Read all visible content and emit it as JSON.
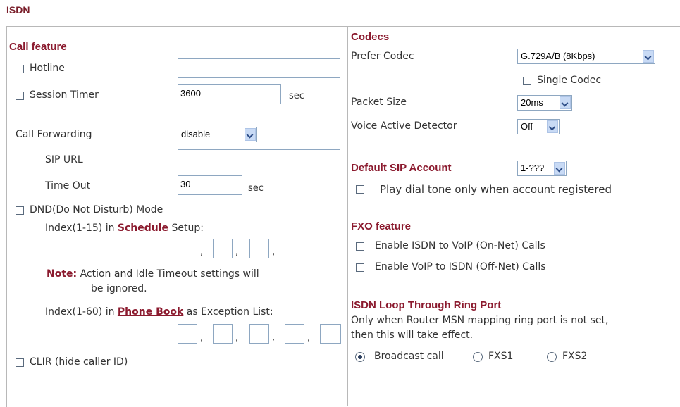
{
  "page_title": "ISDN",
  "left": {
    "call_feature": "Call feature",
    "hotline": {
      "label": "Hotline",
      "checked": false,
      "value": ""
    },
    "session_timer": {
      "label": "Session Timer",
      "checked": false,
      "value": "3600",
      "unit": "sec"
    },
    "call_forwarding": {
      "label": "Call Forwarding",
      "value": "disable"
    },
    "sip_url": {
      "label": "SIP URL",
      "value": ""
    },
    "time_out": {
      "label": "Time Out",
      "value": "30",
      "unit": "sec"
    },
    "dnd": {
      "label": "DND(Do Not Disturb) Mode",
      "checked": false
    },
    "schedule": {
      "prefix": "Index(1-15) in",
      "link": "Schedule",
      "suffix": "Setup:"
    },
    "note": {
      "label": "Note:",
      "line1": "Action and Idle Timeout settings will",
      "line2": "be ignored."
    },
    "phonebook": {
      "prefix": "Index(1-60) in",
      "link": "Phone Book",
      "suffix": "as Exception List:"
    },
    "clir": {
      "label": "CLIR (hide caller ID)",
      "checked": false
    }
  },
  "right": {
    "codecs": "Codecs",
    "prefer_codec": {
      "label": "Prefer Codec",
      "value": "G.729A/B (8Kbps)"
    },
    "single_codec": {
      "label": "Single Codec",
      "checked": false
    },
    "packet_size": {
      "label": "Packet Size",
      "value": "20ms"
    },
    "vad": {
      "label": "Voice Active Detector",
      "value": "Off"
    },
    "default_sip": {
      "label": "Default SIP Account",
      "value": "1-???"
    },
    "play_dial": {
      "label": "Play dial tone only when account registered",
      "checked": false
    },
    "fxo_feature": "FXO feature",
    "isdn_to_voip": {
      "label": "Enable ISDN to VoIP (On-Net) Calls",
      "checked": false
    },
    "voip_to_isdn": {
      "label": "Enable VoIP to ISDN (Off-Net) Calls",
      "checked": false
    },
    "loop_title": "ISDN Loop Through Ring Port",
    "loop_desc1": "Only when Router MSN mapping ring port is not set,",
    "loop_desc2": "then this will take effect.",
    "radios": {
      "broadcast": "Broadcast call",
      "fxs1": "FXS1",
      "fxs2": "FXS2",
      "selected": "Broadcast call"
    }
  }
}
